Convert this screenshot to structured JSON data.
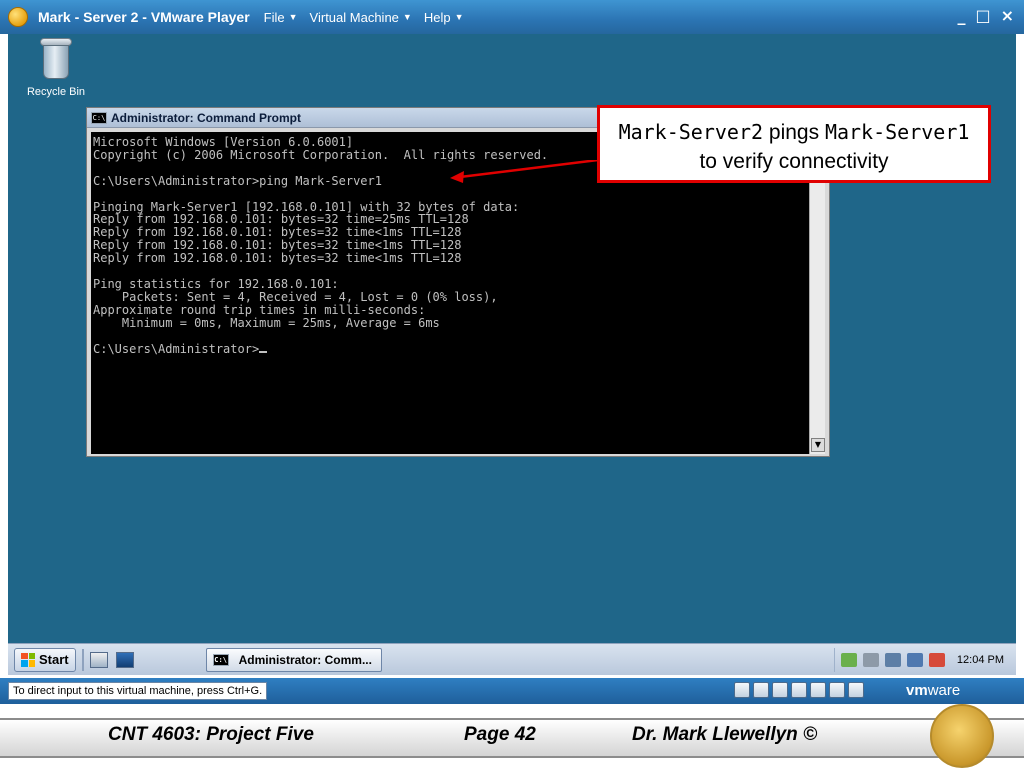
{
  "window": {
    "title": "Mark - Server 2 - VMware Player",
    "menus": [
      "File",
      "Virtual Machine",
      "Help"
    ],
    "controls": [
      "_",
      "□",
      "×"
    ]
  },
  "desktop": {
    "recycle_bin_label": "Recycle Bin"
  },
  "cmd": {
    "title": "Administrator: Command Prompt",
    "icon_text": "C:\\",
    "lines": [
      "Microsoft Windows [Version 6.0.6001]",
      "Copyright (c) 2006 Microsoft Corporation.  All rights reserved.",
      "",
      "C:\\Users\\Administrator>ping Mark-Server1",
      "",
      "Pinging Mark-Server1 [192.168.0.101] with 32 bytes of data:",
      "Reply from 192.168.0.101: bytes=32 time=25ms TTL=128",
      "Reply from 192.168.0.101: bytes=32 time<1ms TTL=128",
      "Reply from 192.168.0.101: bytes=32 time<1ms TTL=128",
      "Reply from 192.168.0.101: bytes=32 time<1ms TTL=128",
      "",
      "Ping statistics for 192.168.0.101:",
      "    Packets: Sent = 4, Received = 4, Lost = 0 (0% loss),",
      "Approximate round trip times in milli-seconds:",
      "    Minimum = 0ms, Maximum = 25ms, Average = 6ms",
      "",
      "C:\\Users\\Administrator>"
    ]
  },
  "callout": {
    "part1_mono": "Mark-Server2",
    "part2_text": " pings ",
    "part3_mono": "Mark-Server1",
    "part4_text": " to verify connectivity"
  },
  "taskbar": {
    "start_label": "Start",
    "task_label": "Administrator: Comm...",
    "clock": "12:04 PM"
  },
  "statusbar": {
    "message": "To direct input to this virtual machine, press Ctrl+G.",
    "logo_bold": "vm",
    "logo_rest": "ware"
  },
  "footer": {
    "course": "CNT 4603: Project Five",
    "page": "Page 42",
    "author": "Dr. Mark Llewellyn ©"
  },
  "colors": {
    "desktop": "#1f6689",
    "callout_border": "#e00000"
  }
}
